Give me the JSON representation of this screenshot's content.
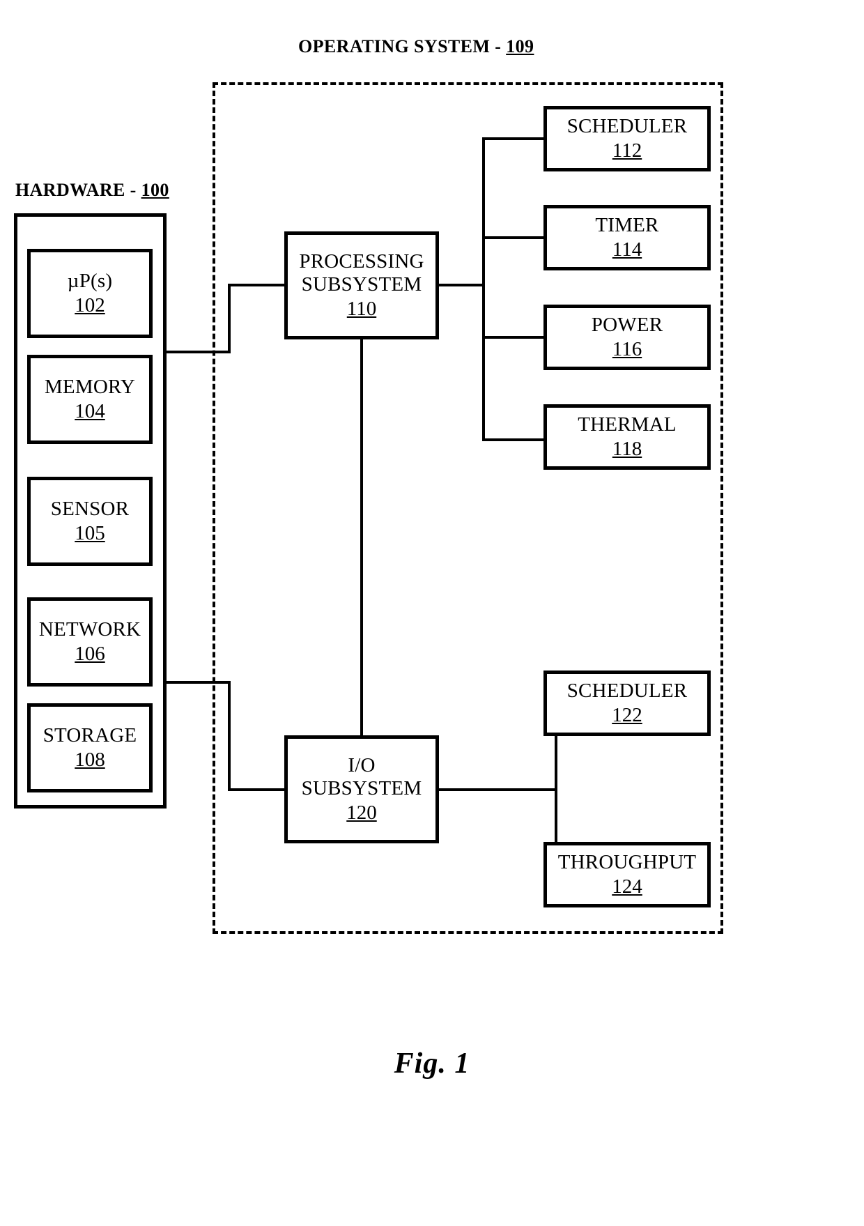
{
  "figure": {
    "caption": "Fig. 1"
  },
  "operating_system": {
    "label": "OPERATING SYSTEM - ",
    "ref": "109"
  },
  "hardware": {
    "label": "HARDWARE - ",
    "ref": "100",
    "components": [
      {
        "title": "µP(s)",
        "ref": "102"
      },
      {
        "title": "MEMORY",
        "ref": "104"
      },
      {
        "title": "SENSOR",
        "ref": "105"
      },
      {
        "title": "NETWORK",
        "ref": "106"
      },
      {
        "title": "STORAGE",
        "ref": "108"
      }
    ]
  },
  "subsystems": {
    "processing": {
      "line1": "PROCESSING",
      "line2": "SUBSYSTEM",
      "ref": "110",
      "services": [
        {
          "title": "SCHEDULER",
          "ref": "112"
        },
        {
          "title": "TIMER",
          "ref": "114"
        },
        {
          "title": "POWER",
          "ref": "116"
        },
        {
          "title": "THERMAL",
          "ref": "118"
        }
      ]
    },
    "io": {
      "line1": "I/O",
      "line2": "SUBSYSTEM",
      "ref": "120",
      "services": [
        {
          "title": "SCHEDULER",
          "ref": "122"
        },
        {
          "title": "THROUGHPUT",
          "ref": "124"
        }
      ]
    }
  },
  "colors": {
    "stroke": "#000000",
    "background": "#ffffff"
  }
}
